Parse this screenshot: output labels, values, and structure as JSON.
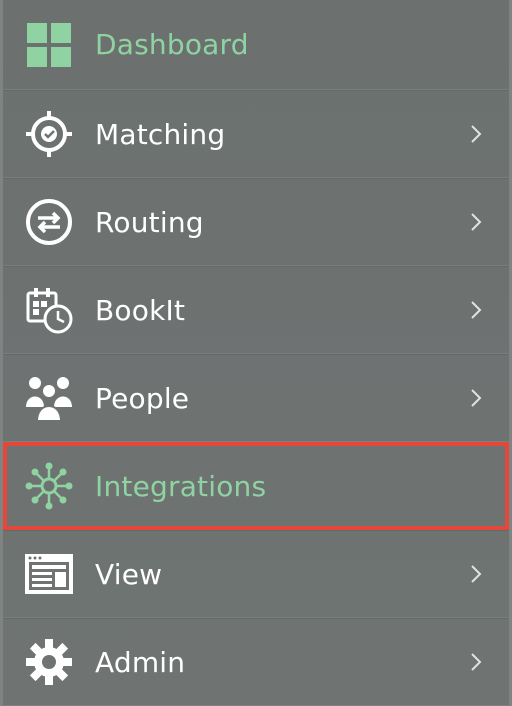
{
  "menu": {
    "items": [
      {
        "label": "Dashboard",
        "icon": "dashboard-grid-icon",
        "has_chevron": false,
        "color": "#8fd3a2"
      },
      {
        "label": "Matching",
        "icon": "target-check-icon",
        "has_chevron": true
      },
      {
        "label": "Routing",
        "icon": "routing-arrows-icon",
        "has_chevron": true
      },
      {
        "label": "BookIt",
        "icon": "calendar-clock-icon",
        "has_chevron": true
      },
      {
        "label": "People",
        "icon": "people-group-icon",
        "has_chevron": true
      },
      {
        "label": "Integrations",
        "icon": "network-hub-icon",
        "has_chevron": false,
        "color": "#8fd3a2",
        "highlight_color": "#e4473c"
      },
      {
        "label": "View",
        "icon": "browser-window-icon",
        "has_chevron": true
      },
      {
        "label": "Admin",
        "icon": "gear-icon",
        "has_chevron": true
      }
    ]
  }
}
